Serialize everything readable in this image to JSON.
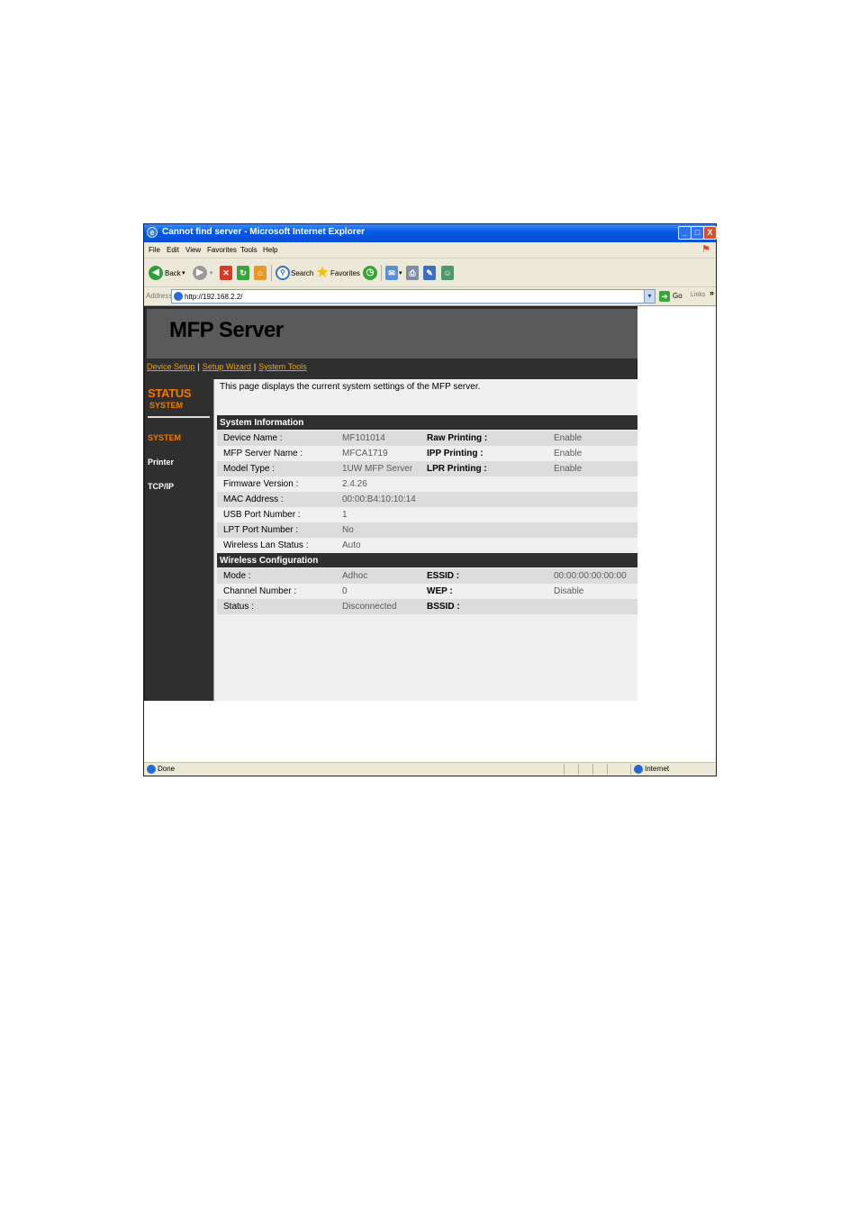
{
  "window": {
    "title": "Cannot find server - Microsoft Internet Explorer",
    "minimize": "_",
    "maximize": "□",
    "close": "X"
  },
  "menu": [
    "File",
    "Edit",
    "View",
    "Favorites",
    "Tools",
    "Help"
  ],
  "toolbar": {
    "back_label": "Back",
    "search_label": "Search",
    "favorites_label": "Favorites"
  },
  "address": {
    "label": "Address",
    "url": "http://192.168.2.2/",
    "go_label": "Go",
    "links_label": "Links",
    "links_chevron": "»"
  },
  "page": {
    "title": "MFP Server",
    "nav": [
      "Device Setup",
      "Setup Wizard",
      "System Tools"
    ],
    "nav_separator": "|",
    "sidebar": {
      "heading": "STATUS",
      "subheading": "SYSTEM",
      "items": [
        "SYSTEM",
        "Printer",
        "TCP/IP"
      ]
    },
    "intro": "This page displays the current system settings of the MFP server.",
    "system_info": {
      "heading": "System Information",
      "rows": [
        {
          "label": "Device Name :",
          "value": "MF101014",
          "label2": "Raw Printing :",
          "value2": "Enable"
        },
        {
          "label": "MFP Server Name :",
          "value": "MFCA1719",
          "label2": "IPP Printing :",
          "value2": "Enable"
        },
        {
          "label": "Model Type :",
          "value": "1UW MFP Server",
          "label2": "LPR Printing :",
          "value2": "Enable"
        },
        {
          "label": "Firmware Version :",
          "value": "2.4.26",
          "label2": "",
          "value2": ""
        },
        {
          "label": "MAC Address :",
          "value": "00:00:B4:10:10:14",
          "label2": "",
          "value2": ""
        },
        {
          "label": "USB Port Number :",
          "value": "1",
          "label2": "",
          "value2": ""
        },
        {
          "label": "LPT Port Number :",
          "value": "No",
          "label2": "",
          "value2": ""
        },
        {
          "label": "Wireless Lan Status :",
          "value": "Auto",
          "label2": "",
          "value2": ""
        }
      ]
    },
    "wireless_config": {
      "heading": "Wireless Configuration",
      "rows": [
        {
          "label": "Mode :",
          "value": "Adhoc",
          "label2": "ESSID :",
          "value2": "00:00:00:00:00:00"
        },
        {
          "label": "Channel Number :",
          "value": "0",
          "label2": "WEP :",
          "value2": "Disable"
        },
        {
          "label": "Status :",
          "value": "Disconnected",
          "label2": "BSSID :",
          "value2": ""
        }
      ]
    }
  },
  "statusbar": {
    "status": "Done",
    "zone": "Internet"
  }
}
